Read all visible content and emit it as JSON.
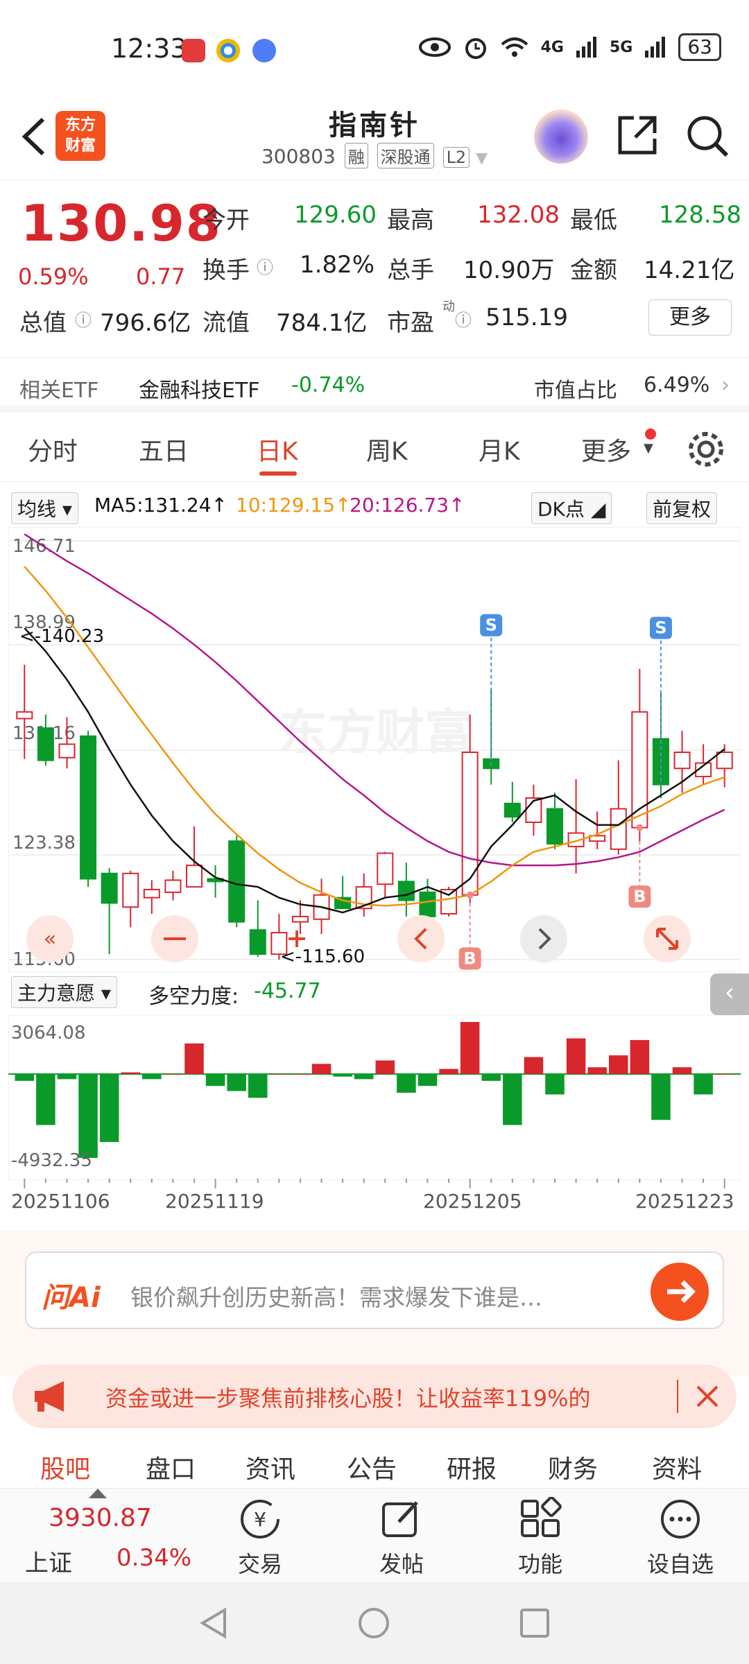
{
  "status_bar": {
    "time": "12:33",
    "network_4g": "4G",
    "network_5g": "5G",
    "battery": "63"
  },
  "header": {
    "logo_text": "东方\n财富",
    "stock_name": "指南针",
    "stock_code": "300803",
    "tags": [
      "融",
      "深股通",
      "L2"
    ]
  },
  "quote": {
    "price": "130.98",
    "change_pct": "0.59%",
    "change_amt": "0.77",
    "open_label": "今开",
    "open_value": "129.60",
    "high_label": "最高",
    "high_value": "132.08",
    "low_label": "最低",
    "low_value": "128.58",
    "turnover_label": "换手",
    "turnover_value": "1.82%",
    "volume_label": "总手",
    "volume_value": "10.90万",
    "amount_label": "金额",
    "amount_value": "14.21亿",
    "mktcap_label": "总值",
    "mktcap_value": "796.6亿",
    "float_label": "流值",
    "float_value": "784.1亿",
    "pe_label": "市盈",
    "pe_sup": "动",
    "pe_value": "515.19",
    "more_button": "更多"
  },
  "etf": {
    "label": "相关ETF",
    "name": "金融科技ETF",
    "change": "-0.74%",
    "ratio_label": "市值占比",
    "ratio_value": "6.49%"
  },
  "tabs": [
    "分时",
    "五日",
    "日K",
    "周K",
    "月K",
    "更多"
  ],
  "ma_row": {
    "selector": "均线",
    "ma5": "MA5:131.24",
    "ma10": "10:129.15",
    "ma20": "20:126.73",
    "dk_button": "DK点",
    "fq_button": "前复权"
  },
  "chart_labels": {
    "y_top": "146.71",
    "y_2": "138.99",
    "y_3": "131.16",
    "y_4": "123.38",
    "y_bottom": "115.60",
    "max_note": "<-140.23",
    "min_note": "<-115.60",
    "watermark": "东方财富",
    "sell_marker": "S",
    "buy_marker": "B"
  },
  "sub_chart": {
    "selector": "主力意愿",
    "force_label": "多空力度:",
    "force_value": "-45.77",
    "y_top": "3064.08",
    "y_bottom": "-4932.35",
    "dates": [
      "20251106",
      "20251119",
      "20251205",
      "20251223"
    ]
  },
  "ai": {
    "logo": "问Ai",
    "prompt": "银价飙升创历史新高！需求爆发下谁是…"
  },
  "banner": {
    "text": "资金或进一步聚焦前排核心股！让收益率119%的"
  },
  "sub_tabs": [
    "股吧",
    "盘口",
    "资讯",
    "公告",
    "研报",
    "财务",
    "资料"
  ],
  "bottom_bar": {
    "index_value": "3930.87",
    "index_name": "上证",
    "index_change": "0.34%",
    "trade": "交易",
    "post": "发帖",
    "functions": "功能",
    "watchlist": "设自选"
  },
  "colors": {
    "up": "#d8262d",
    "down": "#0a9a2a",
    "accent": "#e0432b",
    "ma5": "#111111",
    "ma10": "#f0960a",
    "ma20": "#b5168a",
    "marker": "#4a90e2"
  },
  "chart_data": {
    "type": "candlestick",
    "x_labels": [
      "20251106",
      "20251119",
      "20251205",
      "20251223"
    ],
    "ylim": [
      115.6,
      146.71
    ],
    "y_ticks": [
      146.71,
      138.99,
      131.16,
      123.38,
      115.6
    ],
    "candles": [
      {
        "o": 133.5,
        "h": 137.5,
        "l": 130.5,
        "c": 134.0
      },
      {
        "o": 132.8,
        "h": 133.8,
        "l": 130.0,
        "c": 130.4
      },
      {
        "o": 130.6,
        "h": 133.6,
        "l": 129.8,
        "c": 131.6
      },
      {
        "o": 132.2,
        "h": 132.6,
        "l": 121.0,
        "c": 121.6
      },
      {
        "o": 122.0,
        "h": 122.4,
        "l": 116.0,
        "c": 119.8
      },
      {
        "o": 119.5,
        "h": 122.2,
        "l": 118.0,
        "c": 122.0
      },
      {
        "o": 120.2,
        "h": 121.5,
        "l": 119.0,
        "c": 120.8
      },
      {
        "o": 120.6,
        "h": 122.2,
        "l": 120.0,
        "c": 121.5
      },
      {
        "o": 121.0,
        "h": 125.5,
        "l": 121.0,
        "c": 122.6
      },
      {
        "o": 121.6,
        "h": 122.6,
        "l": 120.2,
        "c": 121.4
      },
      {
        "o": 124.4,
        "h": 124.8,
        "l": 118.0,
        "c": 118.4
      },
      {
        "o": 117.8,
        "h": 120.0,
        "l": 115.8,
        "c": 116.0
      },
      {
        "o": 116.0,
        "h": 119.0,
        "l": 115.6,
        "c": 117.6
      },
      {
        "o": 118.4,
        "h": 120.0,
        "l": 117.5,
        "c": 118.8
      },
      {
        "o": 118.6,
        "h": 121.6,
        "l": 117.5,
        "c": 120.4
      },
      {
        "o": 120.2,
        "h": 121.8,
        "l": 119.6,
        "c": 119.4
      },
      {
        "o": 119.4,
        "h": 122.0,
        "l": 118.8,
        "c": 121.0
      },
      {
        "o": 121.2,
        "h": 123.6,
        "l": 120.2,
        "c": 123.5
      },
      {
        "o": 121.4,
        "h": 122.8,
        "l": 118.8,
        "c": 120.0
      },
      {
        "o": 120.6,
        "h": 121.6,
        "l": 118.4,
        "c": 118.8
      },
      {
        "o": 119.0,
        "h": 121.0,
        "l": 118.8,
        "c": 120.8
      },
      {
        "o": 120.4,
        "h": 133.8,
        "l": 119.8,
        "c": 131.0
      },
      {
        "o": 130.5,
        "h": 135.6,
        "l": 128.6,
        "c": 129.8
      },
      {
        "o": 127.2,
        "h": 128.8,
        "l": 125.8,
        "c": 126.2
      },
      {
        "o": 125.8,
        "h": 128.6,
        "l": 124.8,
        "c": 127.6
      },
      {
        "o": 126.8,
        "h": 128.0,
        "l": 123.8,
        "c": 124.2
      },
      {
        "o": 124.0,
        "h": 129.0,
        "l": 122.0,
        "c": 125.0
      },
      {
        "o": 124.4,
        "h": 126.6,
        "l": 123.8,
        "c": 124.8
      },
      {
        "o": 123.8,
        "h": 130.4,
        "l": 123.4,
        "c": 126.8
      },
      {
        "o": 125.4,
        "h": 137.2,
        "l": 124.4,
        "c": 134.0
      },
      {
        "o": 132.0,
        "h": 135.4,
        "l": 127.6,
        "c": 128.6
      },
      {
        "o": 129.8,
        "h": 132.6,
        "l": 128.0,
        "c": 131.0
      },
      {
        "o": 129.2,
        "h": 131.6,
        "l": 128.6,
        "c": 130.2
      },
      {
        "o": 129.8,
        "h": 131.6,
        "l": 128.4,
        "c": 131.0
      }
    ],
    "ma5": [
      140.23,
      138.5,
      136.4,
      134.0,
      131.2,
      128.6,
      126.3,
      124.4,
      122.9,
      121.7,
      121.2,
      121.0,
      120.2,
      119.7,
      119.5,
      119.1,
      119.6,
      120.2,
      120.4,
      121.0,
      120.4,
      121.6,
      124.0,
      125.6,
      127.4,
      127.8,
      126.6,
      125.6,
      125.6,
      126.8,
      127.8,
      128.8,
      130.0,
      131.24
    ],
    "ma10": [
      144.8,
      143.0,
      141.0,
      138.8,
      136.6,
      134.4,
      132.3,
      130.2,
      128.2,
      126.4,
      124.9,
      123.5,
      122.3,
      121.3,
      120.6,
      120.0,
      119.7,
      119.6,
      119.7,
      119.9,
      120.1,
      120.4,
      121.4,
      122.6,
      123.6,
      124.0,
      124.4,
      124.9,
      125.6,
      126.3,
      127.0,
      127.9,
      128.6,
      129.15
    ],
    "ma20": [
      147.2,
      146.2,
      145.2,
      144.3,
      143.3,
      142.3,
      141.3,
      140.2,
      139.0,
      137.7,
      136.3,
      134.8,
      133.3,
      131.8,
      130.4,
      129.0,
      127.8,
      126.5,
      125.4,
      124.4,
      123.6,
      123.1,
      122.8,
      122.6,
      122.6,
      122.6,
      122.7,
      122.9,
      123.2,
      123.6,
      124.4,
      125.2,
      126.0,
      126.73
    ],
    "sell_markers": [
      22,
      30
    ],
    "buy_markers": [
      21,
      29
    ],
    "sub_series": {
      "name": "主力意愿",
      "ylim": [
        -4932.35,
        3064.08
      ],
      "values": [
        -400,
        -3000,
        -300,
        -4932,
        -4000,
        100,
        -300,
        0,
        1800,
        -700,
        -1000,
        -1400,
        0,
        0,
        600,
        -150,
        -300,
        800,
        -1100,
        -700,
        300,
        3064,
        -400,
        -3000,
        1000,
        -1200,
        2100,
        400,
        1100,
        2000,
        -2700,
        400,
        -1200,
        0
      ]
    }
  }
}
